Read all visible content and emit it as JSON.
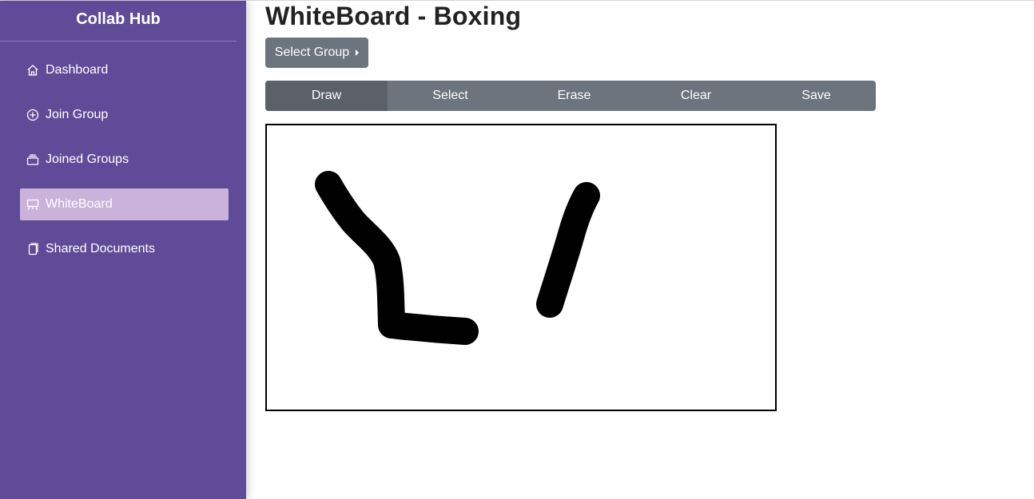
{
  "app": {
    "brand": "Collab Hub"
  },
  "sidebar": {
    "items": [
      {
        "label": "Dashboard",
        "icon": "house-icon",
        "active": false
      },
      {
        "label": "Join Group",
        "icon": "plus-circle-icon",
        "active": false
      },
      {
        "label": "Joined Groups",
        "icon": "collection-icon",
        "active": false
      },
      {
        "label": "WhiteBoard",
        "icon": "easel-icon",
        "active": true
      },
      {
        "label": "Shared Documents",
        "icon": "documents-icon",
        "active": false
      }
    ]
  },
  "header": {
    "title": "WhiteBoard - Boxing"
  },
  "group_select": {
    "label": "Select Group"
  },
  "toolbar": {
    "draw": "Draw",
    "select": "Select",
    "erase": "Erase",
    "clear": "Clear",
    "save": "Save",
    "active": "Draw"
  },
  "colors": {
    "sidebar_bg": "#5f4b97",
    "sidebar_active": "#cbb2db",
    "button_gray": "#6c757d",
    "button_active": "#5a6268",
    "stroke": "#000000"
  }
}
